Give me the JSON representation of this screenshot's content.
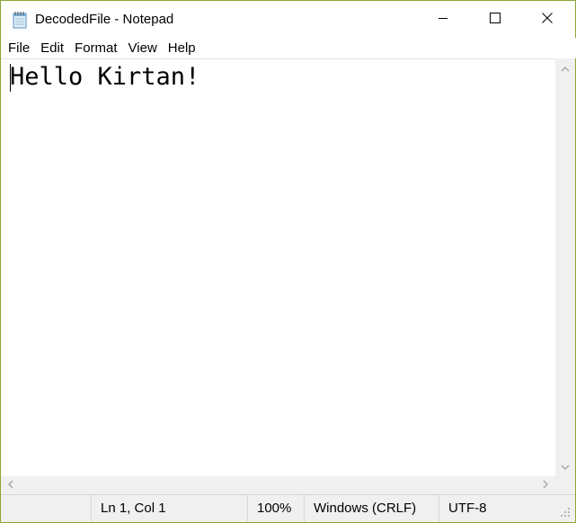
{
  "window": {
    "title": "DecodedFile - Notepad",
    "app_icon": "notepad-icon",
    "controls": {
      "minimize_icon": "minimize-icon",
      "maximize_icon": "maximize-icon",
      "close_icon": "close-icon"
    },
    "border_color": "#8aa834"
  },
  "menu": {
    "items": [
      {
        "label": "File"
      },
      {
        "label": "Edit"
      },
      {
        "label": "Format"
      },
      {
        "label": "View"
      },
      {
        "label": "Help"
      }
    ]
  },
  "editor": {
    "content": "Hello Kirtan!"
  },
  "status": {
    "position": "Ln 1, Col 1",
    "zoom": "100%",
    "line_ending": "Windows (CRLF)",
    "encoding": "UTF-8"
  }
}
